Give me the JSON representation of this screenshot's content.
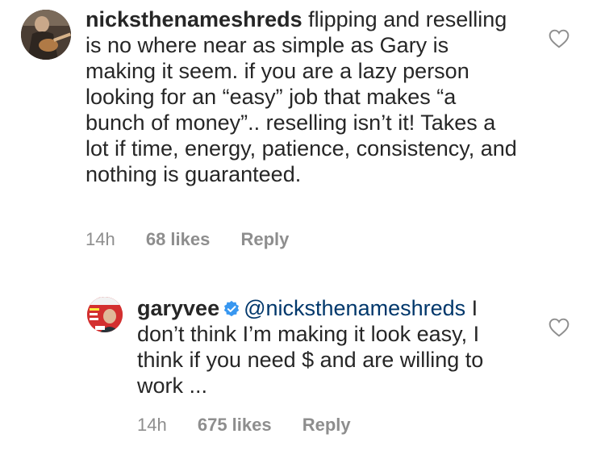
{
  "comments": [
    {
      "username": "nicksthenameshreds",
      "text": "flipping and reselling is no where near as simple as Gary is making it seem. if you are a lazy person looking for an “easy” job that makes “a bunch of money”.. reselling isn’t it! Takes a lot if time, energy, patience, consistency, and nothing is guaranteed.",
      "time": "14h",
      "likes": "68 likes",
      "reply_label": "Reply",
      "avatar_icon": "guitar-player-avatar",
      "like_icon": "heart-outline-icon"
    },
    {
      "username": "garyvee",
      "verified": true,
      "mention": "@nicksthenameshreds",
      "text": "I don’t think I’m making it look easy, I think if you need $ and are willing to work ...",
      "time": "14h",
      "likes": "675 likes",
      "reply_label": "Reply",
      "avatar_icon": "magazine-cover-avatar",
      "like_icon": "heart-outline-icon"
    }
  ],
  "colors": {
    "text": "#262626",
    "muted": "#8e8e8e",
    "mention": "#00376b",
    "verified": "#3897f0"
  }
}
